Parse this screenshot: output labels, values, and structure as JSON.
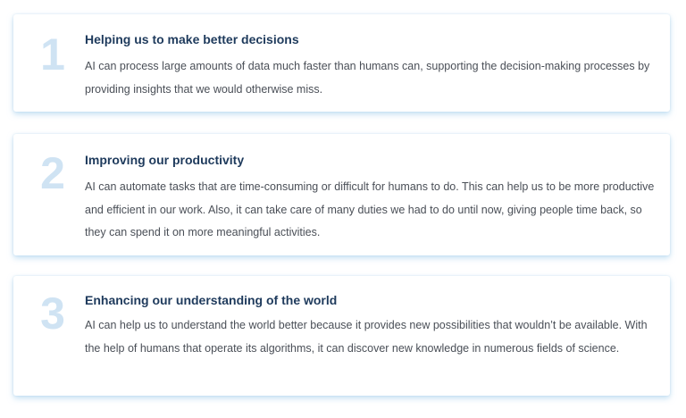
{
  "items": [
    {
      "number": "1",
      "title": "Helping us to make better decisions",
      "text": "AI can process large amounts of data much faster than humans can, supporting the decision-making processes by providing insights that we would otherwise miss."
    },
    {
      "number": "2",
      "title": "Improving our productivity",
      "text": "AI can automate tasks that are time-consuming or difficult for humans to do. This can help us to be more productive and efficient in our work. Also, it can take care of many duties we had to do until now, giving people time back, so they can spend it on more meaningful activities."
    },
    {
      "number": "3",
      "title": "Enhancing our understanding of the world",
      "text": "AI can help us to understand the world better because it provides new possibilities that wouldn’t be available. With the help of humans that operate its algorithms, it can discover new knowledge in numerous fields of science."
    }
  ],
  "colors": {
    "number": "#cfe3f3",
    "title": "#1e3a5c",
    "body": "#4a4f57",
    "card_shadow": "#96c8eb"
  }
}
